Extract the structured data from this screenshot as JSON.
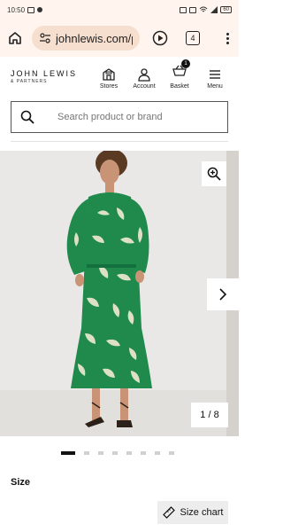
{
  "status_bar": {
    "time": "10:50"
  },
  "browser": {
    "url": "johnlewis.com/p",
    "tab_count": "4"
  },
  "header": {
    "logo_main": "JOHN LEWIS",
    "logo_sub": "& PARTNERS",
    "nav": [
      {
        "label": "Stores",
        "icon": "store-icon"
      },
      {
        "label": "Account",
        "icon": "account-icon"
      },
      {
        "label": "Basket",
        "icon": "basket-icon",
        "count": "1"
      },
      {
        "label": "Menu",
        "icon": "menu-icon"
      }
    ]
  },
  "search": {
    "placeholder": "Search product or brand"
  },
  "gallery": {
    "counter": "1 / 8",
    "total_slides": 8,
    "active_slide": 1
  },
  "product": {
    "size_heading": "Size",
    "size_chart_label": "Size chart"
  },
  "colors": {
    "browser_bg": "#fff5ee",
    "url_pill": "#f6dfcf",
    "dress_green": "#1f8a4c",
    "leaf_cream": "#f2ead4"
  }
}
